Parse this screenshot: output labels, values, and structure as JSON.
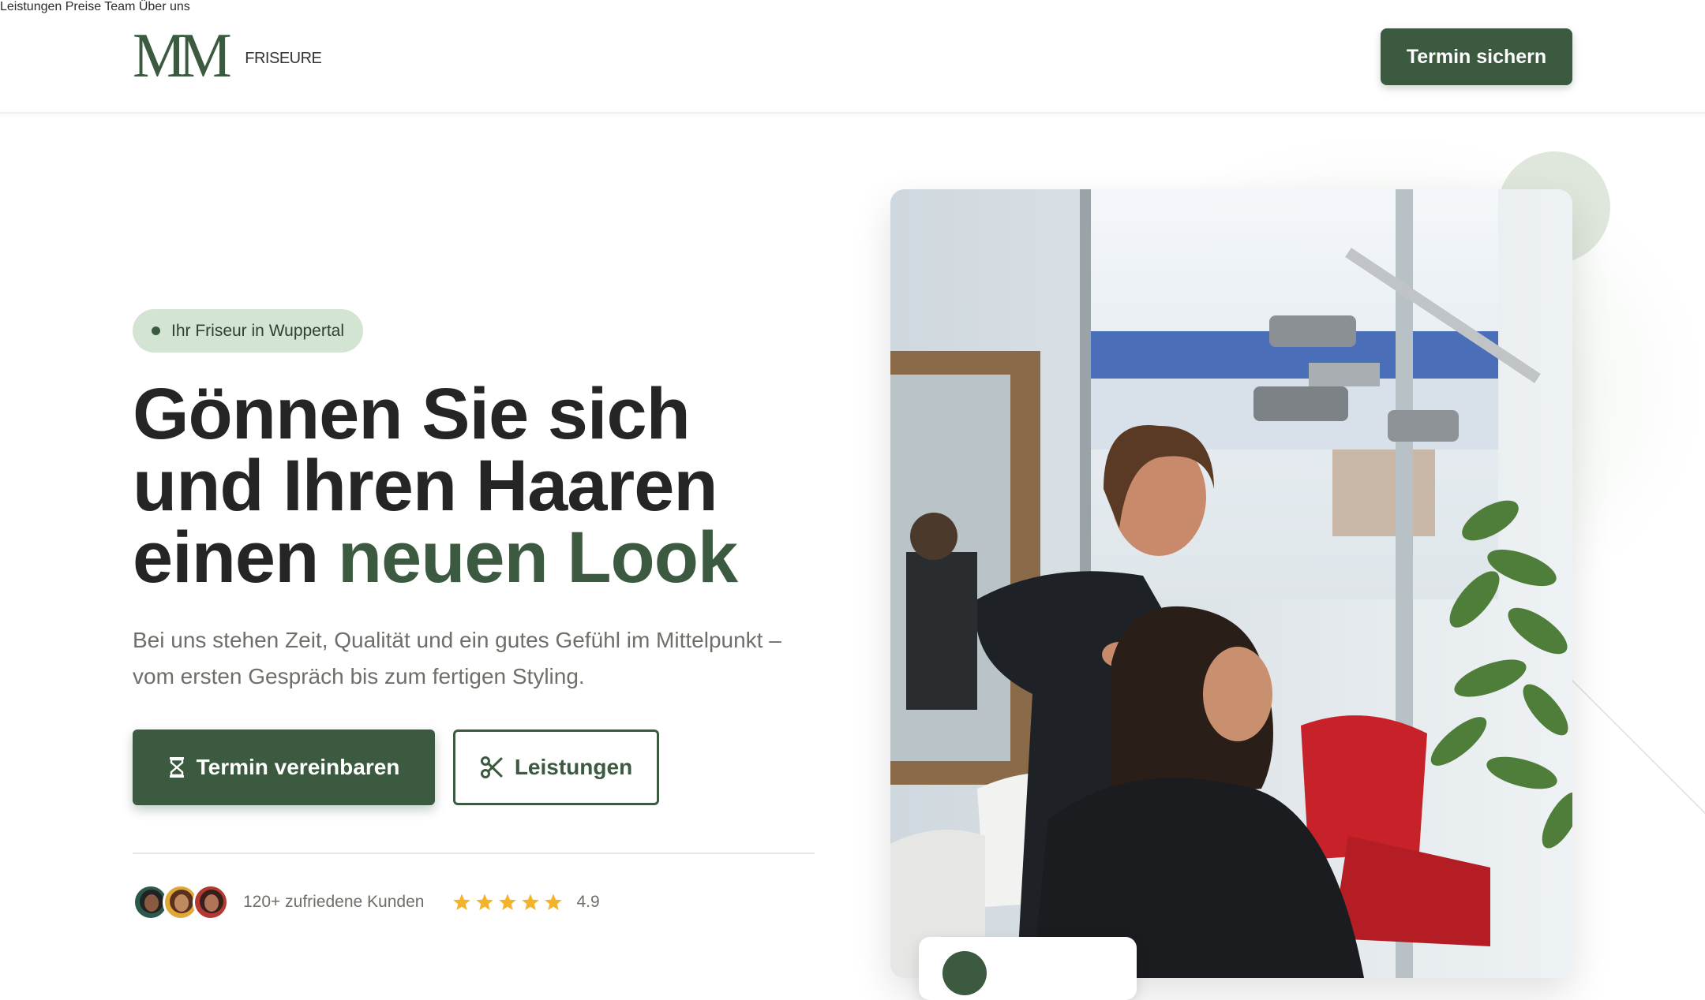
{
  "header": {
    "logo_mark": "MM",
    "logo_text": "FRISEURE",
    "nav": [
      "Leistungen",
      "Preise",
      "Team",
      "Über uns"
    ],
    "cta_label": "Termin sichern"
  },
  "hero": {
    "badge": "Ihr Friseur in Wuppertal",
    "headline_line1": "Gönnen Sie sich",
    "headline_line2": "und Ihren Haaren",
    "headline_line3_plain": "einen ",
    "headline_line3_accent": "neuen Look",
    "subtext_line1": "Bei uns stehen Zeit, Qualität und ein gutes Gefühl im Mittelpunkt –",
    "subtext_line2": "vom ersten Gespräch bis zum fertigen Styling.",
    "primary_button": "Termin vereinbaren",
    "primary_button_icon": "hourglass-icon",
    "secondary_button": "Leistungen",
    "secondary_button_icon": "scissors-icon",
    "customers_text": "120+ zufriedene Kunden",
    "star_count": 5,
    "rating": "4.9"
  },
  "colors": {
    "accent": "#3b5a40",
    "badge_bg": "#d4e4d3",
    "star": "#f4b42a",
    "text": "#252525",
    "muted": "#6b7068"
  }
}
